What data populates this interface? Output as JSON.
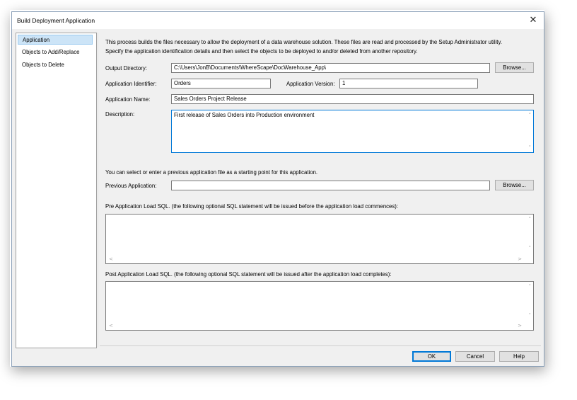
{
  "window": {
    "title": "Build Deployment Application",
    "close_glyph": "✕"
  },
  "nav": {
    "items": [
      {
        "label": "Application",
        "selected": true
      },
      {
        "label": "Objects to Add/Replace",
        "selected": false
      },
      {
        "label": "Objects to Delete",
        "selected": false
      }
    ]
  },
  "intro": {
    "line1": "This process builds the files necessary to allow the deployment of a data warehouse solution. These files are read and processed by the Setup Administrator utility.",
    "line2": "Specify the application identification details and then select the objects to be deployed to and/or deleted from another repository."
  },
  "form": {
    "output_directory": {
      "label": "Output Directory:",
      "value": "C:\\Users\\JonB\\Documents\\WhereScape\\DocWarehouse_App\\",
      "browse_label": "Browse..."
    },
    "application_identifier": {
      "label": "Application Identifier:",
      "value": "Orders"
    },
    "application_version": {
      "label": "Application Version:",
      "value": "1"
    },
    "application_name": {
      "label": "Application Name:",
      "value": "Sales Orders Project Release"
    },
    "description": {
      "label": "Description:",
      "value": "First release of Sales Orders into Production environment"
    },
    "previous_hint": "You can select or enter a previous application file as a starting point for this application.",
    "previous_application": {
      "label": "Previous Application:",
      "value": "",
      "browse_label": "Browse..."
    },
    "pre_load_sql_label": "Pre Application Load SQL. (the following optional SQL statement will be issued before the application load commences):",
    "post_load_sql_label": "Post Application Load SQL. (the following optional SQL statement will be issued after the application load completes):"
  },
  "footer": {
    "ok_label": "OK",
    "cancel_label": "Cancel",
    "help_label": "Help"
  },
  "icons": {
    "scroll_up": "˄",
    "scroll_down": "˅",
    "scroll_left": "<",
    "scroll_right": ">"
  },
  "colors": {
    "selection": "#cce4f7",
    "focus_border": "#0078d7",
    "dialog_bg": "#f0f0f0"
  }
}
